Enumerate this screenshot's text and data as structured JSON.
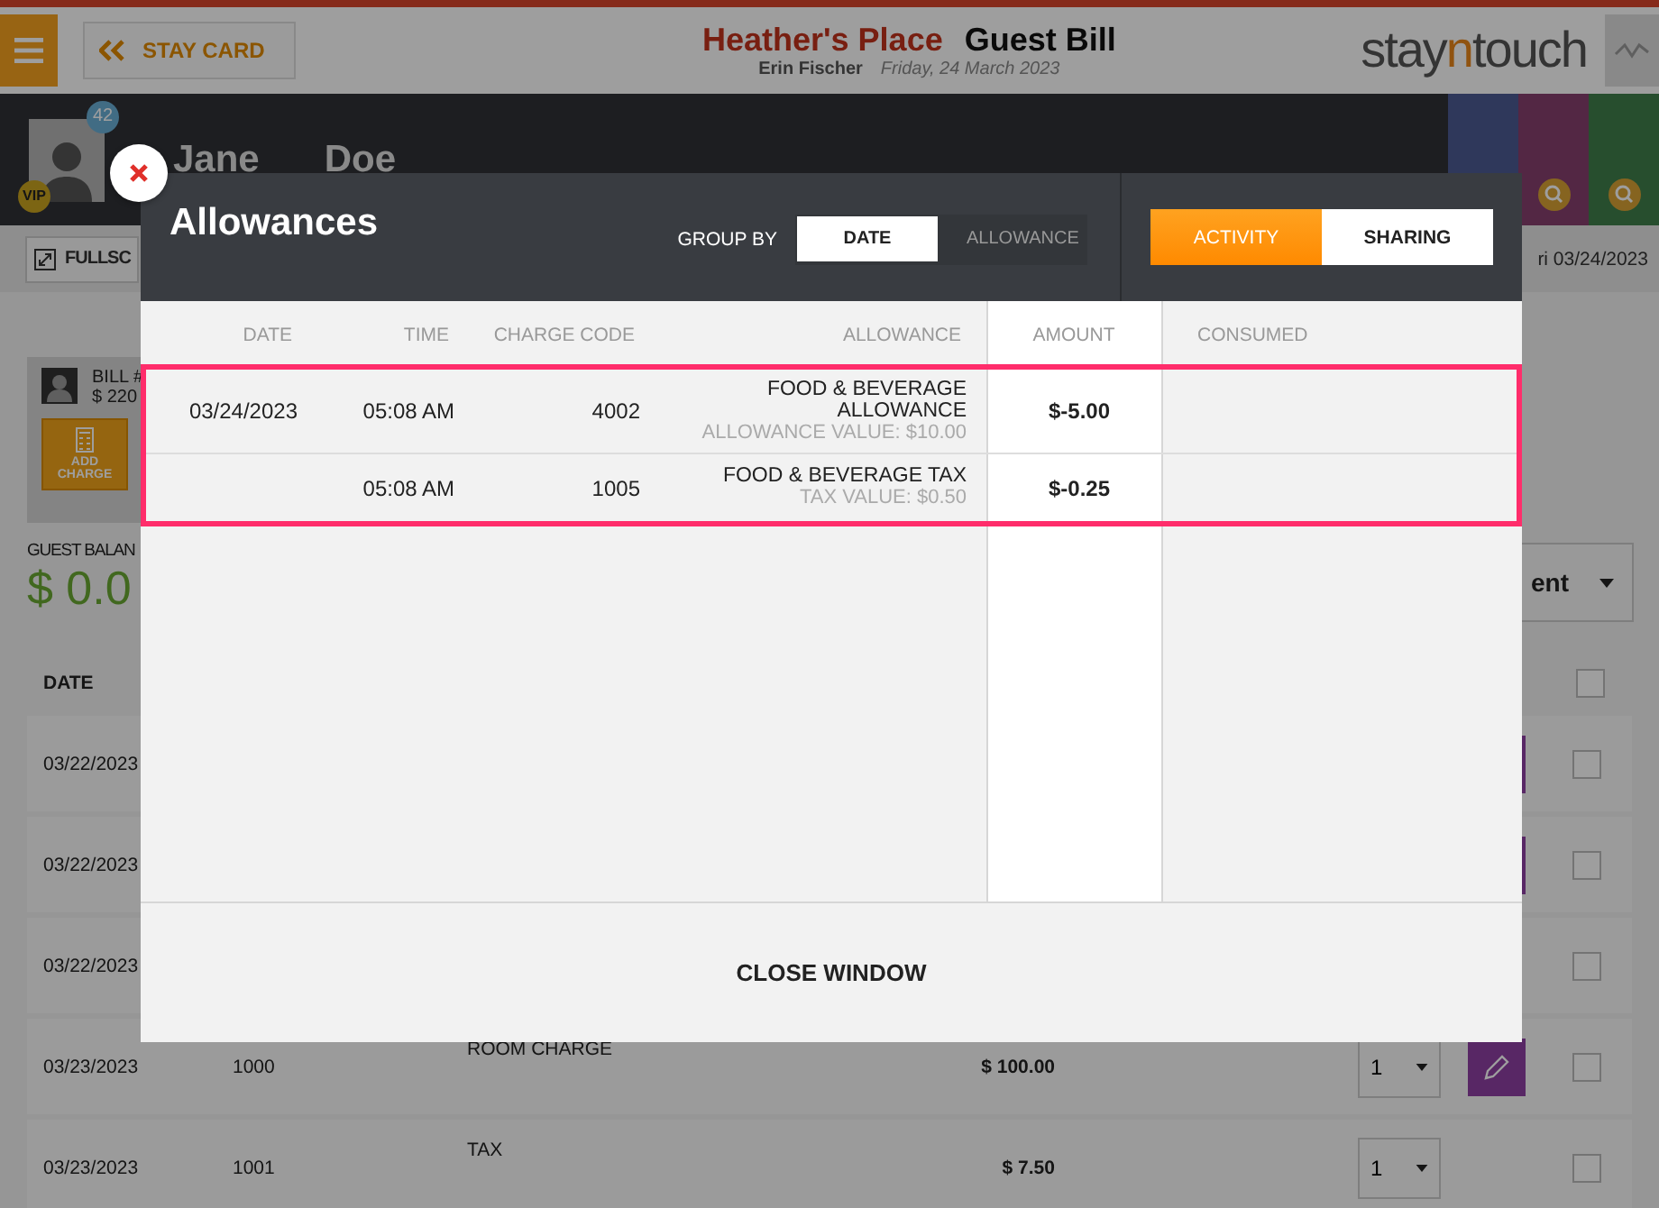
{
  "header": {
    "back_button": "STAY CARD",
    "hotel": "Heather's Place",
    "title": "Guest Bill",
    "user": "Erin Fischer",
    "date": "Friday, 24 March 2023",
    "logo": {
      "start": "stay",
      "accent": "n",
      "end": "touch"
    }
  },
  "guest": {
    "first_name": "Jane",
    "last_name": "Doe",
    "badge": "42",
    "vip": "VIP"
  },
  "subbar": {
    "fullscreen": "FULLSC",
    "date": "ri 03/24/2023"
  },
  "bill": {
    "label": "BILL #",
    "amount": "$ 220",
    "add_charge": "ADD CHARGE",
    "balance_label": "GUEST BALAN",
    "balance": "$ 0.0",
    "dropdown": "ent"
  },
  "bill_table": {
    "columns": [
      "DATE"
    ],
    "header_checked": false,
    "rows": [
      {
        "date": "03/22/2023",
        "editable": true,
        "checked": false
      },
      {
        "date": "03/22/2023",
        "editable": true,
        "checked": false
      },
      {
        "date": "03/22/2023",
        "editable": false,
        "checked": false
      },
      {
        "date": "03/23/2023",
        "code": "1000",
        "description": "ROOM CHARGE",
        "amount": "$ 100.00",
        "quantity": "1",
        "editable": true,
        "checked": false
      },
      {
        "date": "03/23/2023",
        "code": "1001",
        "description": "TAX",
        "amount": "$ 7.50",
        "quantity": "1",
        "editable": false,
        "checked": false
      }
    ]
  },
  "modal": {
    "title": "Allowances",
    "group_by": {
      "label": "GROUP BY",
      "options": [
        {
          "label": "DATE",
          "selected": true
        },
        {
          "label": "ALLOWANCE",
          "selected": false
        }
      ]
    },
    "tabs": [
      {
        "label": "ACTIVITY",
        "selected": true
      },
      {
        "label": "SHARING",
        "selected": false
      }
    ],
    "table": {
      "columns": [
        "DATE",
        "TIME",
        "CHARGE CODE",
        "ALLOWANCE",
        "AMOUNT",
        "CONSUMED"
      ],
      "highlighted": true,
      "rows": [
        {
          "date": "03/24/2023",
          "time": "05:08 AM",
          "charge_code": "4002",
          "allowance": "FOOD & BEVERAGE ALLOWANCE",
          "detail": "ALLOWANCE VALUE: $10.00",
          "amount": "$-5.00"
        },
        {
          "time": "05:08 AM",
          "charge_code": "1005",
          "allowance": "FOOD & BEVERAGE TAX",
          "detail": "TAX VALUE: $0.50",
          "amount": "$-0.25"
        }
      ]
    },
    "close_button": "CLOSE WINDOW"
  }
}
